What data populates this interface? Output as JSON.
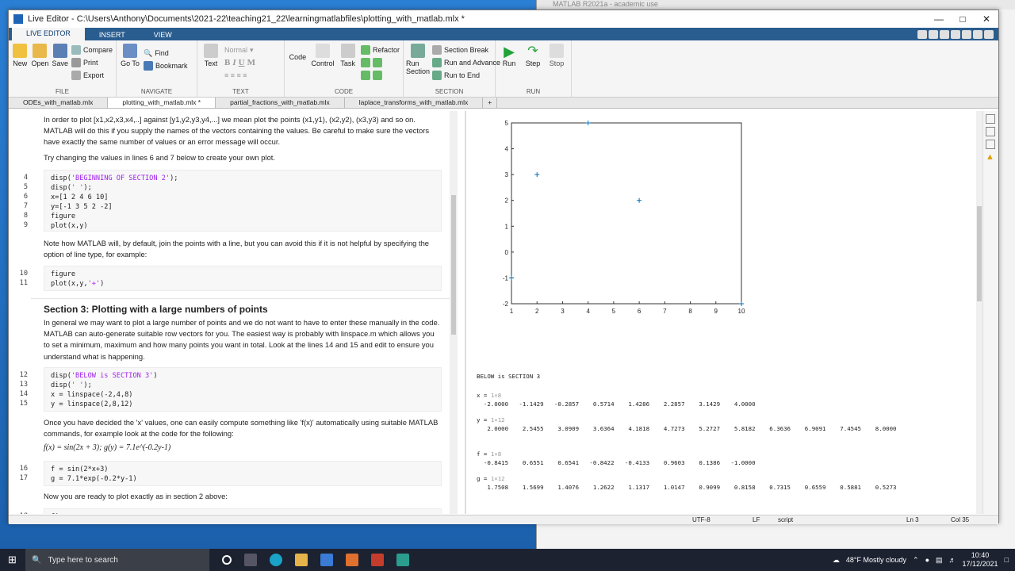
{
  "window": {
    "title": "Live Editor - C:\\Users\\Anthony\\Documents\\2021-22\\teaching21_22\\learningmatlabfiles\\plotting_with_matlab.mlx *",
    "bg_title": "MATLAB R2021a - academic use"
  },
  "ribbon_tabs": [
    "LIVE EDITOR",
    "INSERT",
    "VIEW"
  ],
  "ribbon": {
    "file": {
      "label": "FILE",
      "new": "New",
      "open": "Open",
      "save": "Save",
      "compare": "Compare",
      "print": "Print",
      "export": "Export"
    },
    "navigate": {
      "label": "NAVIGATE",
      "goto": "Go To",
      "find": "Find",
      "bookmark": "Bookmark"
    },
    "text": {
      "label": "TEXT",
      "text": "Text",
      "style": "Normal",
      "bold": "B",
      "italic": "I",
      "underline": "U",
      "mono": "M"
    },
    "code": {
      "label": "CODE",
      "code": "Code",
      "control": "Control",
      "task": "Task",
      "refactor": "Refactor"
    },
    "section": {
      "label": "SECTION",
      "run_section": "Run Section",
      "section_break": "Section Break",
      "run_advance": "Run and Advance",
      "run_end": "Run to End"
    },
    "run": {
      "label": "RUN",
      "run": "Run",
      "step": "Step",
      "stop": "Stop"
    }
  },
  "doc_tabs": [
    "ODEs_with_matlab.mlx",
    "plotting_with_matlab.mlx *",
    "partial_fractions_with_matlab.mlx",
    "laplace_transforms_with_matlab.mlx",
    "+"
  ],
  "editor": {
    "p1": "In order to plot  [x1,x2,x3,x4,..] against [y1,y2,y3,y4,...] we mean plot the points (x1,y1), (x2,y2), (x3,y3) and so on. MATLAB will do this if you supply the names of the vectors containing the values.  Be careful to make sure the vectors have exactly the same number of values or an error message will occur.",
    "p2": "Try changing the values in lines 6 and 7 below to create your own plot.",
    "code1": {
      "lines": [
        "4",
        "5",
        "6",
        "7",
        "8",
        "9"
      ],
      "c1": "disp(",
      "s1": "'BEGINNING OF SECTION 2'",
      "e1": ");",
      "c2": "disp(",
      "s2": "' '",
      "e2": ");",
      "l6": "x=[1 2 4 6 10]",
      "l7": "y=[-1 3 5 2 -2]",
      "l8": "figure",
      "l9": "plot(x,y)"
    },
    "p3": "Note how MATLAB will, by default, join the points with a line, but you can avoid this if it is not helpful by specifying the option of line type, for example:",
    "code2": {
      "lines": [
        "10",
        "11"
      ],
      "l10": "figure",
      "l11a": "plot(x,y,",
      "l11s": "'+'",
      "l11b": ")"
    },
    "section3_title": "Section 3: Plotting with a large numbers of points",
    "p4": "In general we may want to plot a large number of points and we do not want to have to enter these manually in the code. MATLAB can auto-generate suitable row vectors for you. The easiest way is probably with linspace.m which allows you to set a minimum, maximum and how many points you want in total. Look at the lines 14 and 15 and edit to ensure you understand what is happening.",
    "code3": {
      "lines": [
        "12",
        "13",
        "14",
        "15"
      ],
      "c1": "disp(",
      "s1": "'BELOW is SECTION 3'",
      "e1": ")",
      "c2": "disp(",
      "s2": "' '",
      "e2": ");",
      "l14": "x = linspace(-2,4,8)",
      "l15": "y = linspace(2,8,12)"
    },
    "p5": "Once you have decided the 'x' values, one can easily compute something like 'f(x)' automatically using suitable MATLAB commands, for example look at the code for the following:",
    "math": "f(x) = sin(2x + 3);  g(y) = 7.1e^(-0.2y-1)",
    "code4": {
      "lines": [
        "16",
        "17"
      ],
      "l16": "f = sin(2*x+3)",
      "l17": "g = 7.1*exp(-0.2*y-1)"
    },
    "p6": "Now you are ready to plot exactly as in section 2 above:",
    "code5": {
      "lines": [
        "18"
      ],
      "l18": "figure"
    }
  },
  "chart_data": {
    "type": "scatter",
    "marker": "+",
    "x": [
      1,
      2,
      4,
      6,
      10
    ],
    "y": [
      -1,
      3,
      5,
      2,
      -2
    ],
    "xlim": [
      1,
      10
    ],
    "ylim": [
      -2,
      5
    ],
    "xticks": [
      "1",
      "2",
      "3",
      "4",
      "5",
      "6",
      "7",
      "8",
      "9",
      "10"
    ],
    "yticks": [
      "5",
      "4",
      "3",
      "2",
      "1",
      "0",
      "-1",
      "-2"
    ],
    "color": "#0072bd"
  },
  "output": {
    "heading": "BELOW is SECTION 3",
    "x_label": "x = ",
    "x_dim": "1×8",
    "x_vals": "  -2.0000   -1.1429   -0.2857    0.5714    1.4286    2.2857    3.1429    4.0000",
    "y_label": "y = ",
    "y_dim": "1×12",
    "y_vals": "   2.0000    2.5455    3.0909    3.6364    4.1818    4.7273    5.2727    5.8182    6.3636    6.9091    7.4545    8.0000",
    "f_label": "f = ",
    "f_dim": "1×8",
    "f_vals": "  -0.8415    0.6551    0.6541   -0.8422   -0.4133    0.9603    0.1386   -1.0000",
    "g_label": "g = ",
    "g_dim": "1×12",
    "g_vals": "   1.7508    1.5699    1.4076    1.2622    1.1317    1.0147    0.9099    0.8158    0.7315    0.6559    0.5881    0.5273",
    "next_plot_tick": "2"
  },
  "status": {
    "encoding": "UTF-8",
    "eol": "LF",
    "mode": "script",
    "ln": "Ln  3",
    "col": "Col  35"
  },
  "taskbar": {
    "search_placeholder": "Type here to search",
    "weather": "48°F  Mostly cloudy",
    "time": "10:40",
    "date": "17/12/2021"
  }
}
